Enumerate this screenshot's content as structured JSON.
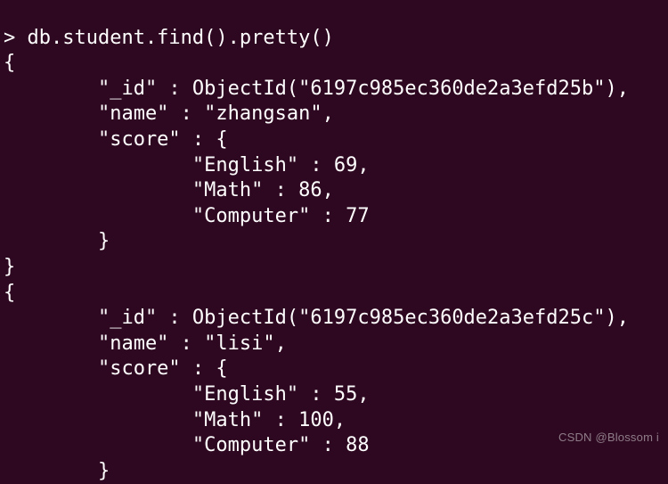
{
  "command_line": "> db.student.find().pretty()",
  "docs": [
    {
      "open": "{",
      "id_line": "        \"_id\" : ObjectId(\"6197c985ec360de2a3efd25b\"),",
      "name_line": "        \"name\" : \"zhangsan\",",
      "score_open": "        \"score\" : {",
      "english": "                \"English\" : 69,",
      "math": "                \"Math\" : 86,",
      "computer": "                \"Computer\" : 77",
      "score_close": "        }",
      "close": "}"
    },
    {
      "open": "{",
      "id_line": "        \"_id\" : ObjectId(\"6197c985ec360de2a3efd25c\"),",
      "name_line": "        \"name\" : \"lisi\",",
      "score_open": "        \"score\" : {",
      "english": "                \"English\" : 55,",
      "math": "                \"Math\" : 100,",
      "computer": "                \"Computer\" : 88",
      "score_close": "        }",
      "close": ""
    }
  ],
  "watermark": "CSDN @Blossom i"
}
